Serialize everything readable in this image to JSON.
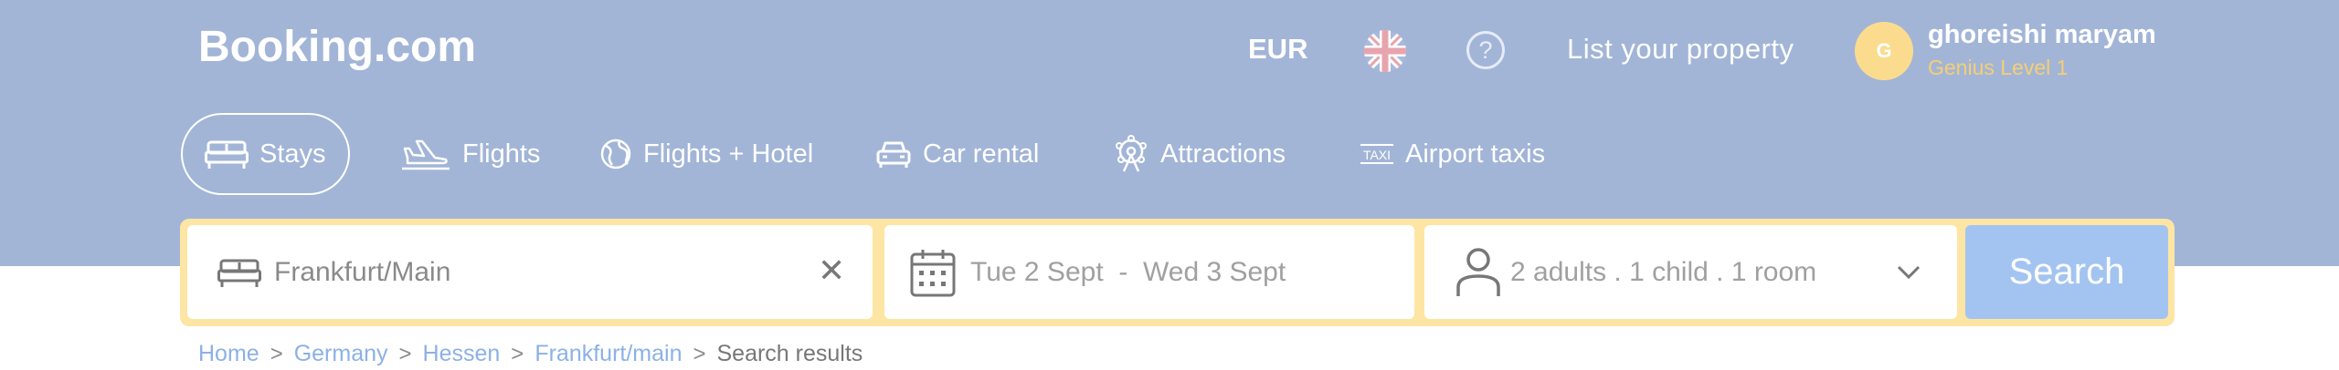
{
  "header": {
    "logo": "Booking.com",
    "currency": "EUR",
    "help_symbol": "?",
    "list_property": "List your property",
    "user": {
      "avatar_initial": "G",
      "name": "ghoreishi maryam",
      "level": "Genius Level 1"
    }
  },
  "nav": {
    "tabs": [
      {
        "label": "Stays",
        "icon": "bed-icon",
        "active": true
      },
      {
        "label": "Flights",
        "icon": "plane-icon"
      },
      {
        "label": "Flights + Hotel",
        "icon": "globe-icon"
      },
      {
        "label": "Car rental",
        "icon": "car-icon"
      },
      {
        "label": "Attractions",
        "icon": "ferris-wheel-icon"
      },
      {
        "label": "Airport taxis",
        "icon": "taxi-icon",
        "icon_text": "TAXI"
      }
    ]
  },
  "search": {
    "destination": "Frankfurt/Main",
    "clear_symbol": "✕",
    "dates": "Tue 2 Sept  -  Wed 3 Sept",
    "occupancy": "2 adults . 1 child . 1 room",
    "button": "Search"
  },
  "breadcrumb": {
    "items": [
      "Home",
      "Germany",
      "Hessen",
      "Frankfurt/main"
    ],
    "current": "Search results"
  },
  "colors": {
    "header_bg": "#a2b5d7",
    "search_border": "#fde5a4",
    "search_button": "#a3c4f1",
    "genius": "#f5cf74",
    "link": "#8cb1e6"
  }
}
